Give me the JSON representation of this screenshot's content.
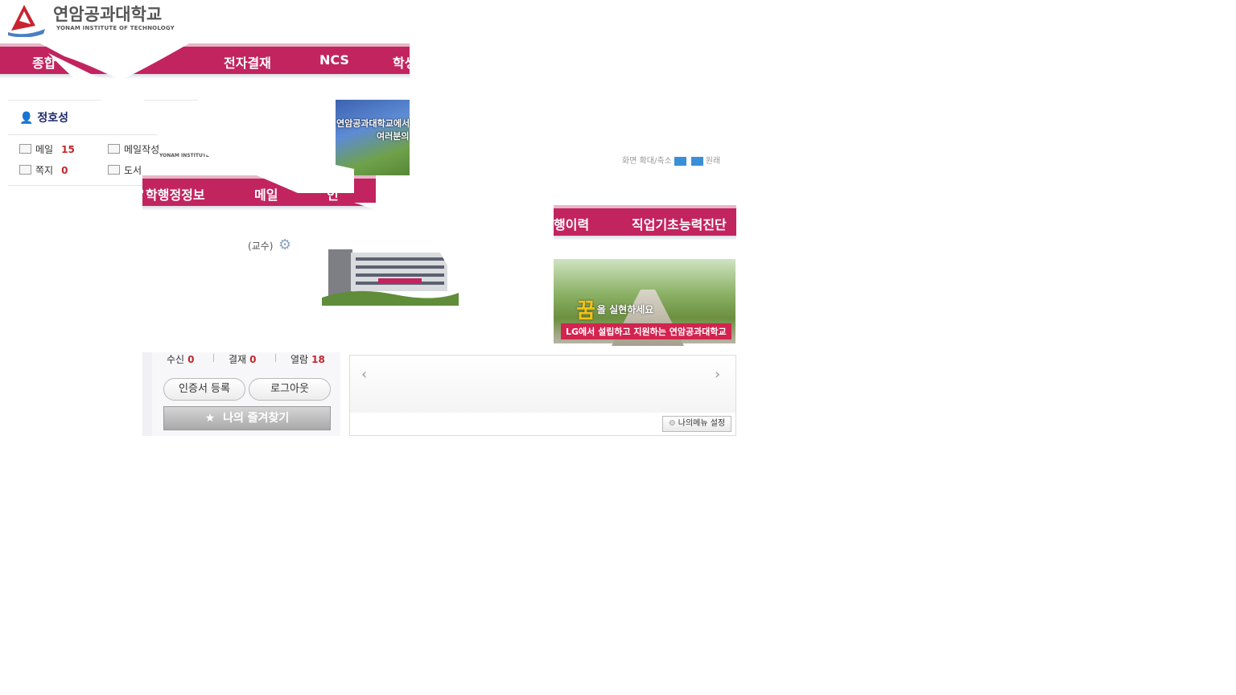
{
  "logo": {
    "title": "연암공과대학교",
    "subtitle": "YONAM INSTITUTE OF TECHNOLOGY",
    "icon": "university-logo-icon"
  },
  "nav_top": {
    "items": [
      "종합",
      "전자결재",
      "NCS",
      "학생"
    ]
  },
  "nav_mid": {
    "items": [
      "학행정정보",
      "메일",
      "인"
    ]
  },
  "nav_right": {
    "items": [
      "행이력",
      "직업기초능력진단"
    ]
  },
  "user": {
    "name": "정호성",
    "role": "(교수)",
    "mail_label": "메일",
    "mail_count": "15",
    "mail_write_label": "메일작성",
    "note_label": "쪽지",
    "note_count": "0",
    "library_label": "도서",
    "receive_label": "수신",
    "receive_count": "0",
    "approval_label": "결재",
    "approval_count": "0",
    "view_label": "열람",
    "view_count": "18"
  },
  "buttons": {
    "cert_register": "인증서 등록",
    "logout": "로그아웃",
    "favorites": "나의 즐겨찾기",
    "my_menu": "나의메뉴 설정"
  },
  "banners": {
    "top_text_1": "연암공과대학교에서",
    "top_text_2": "여러분의",
    "top_logo_text": "YONAM INSTITUTE OF",
    "right_slogan_big": "꿈",
    "right_slogan": "을 실현하세요",
    "right_caption": "LG에서 설립하고 지원하는 연암공과대학교"
  },
  "small_info": "화면 확대/축소",
  "small_info_right": "원래",
  "colors": {
    "nav": "#c2245f",
    "accent_number": "#c0282d"
  }
}
